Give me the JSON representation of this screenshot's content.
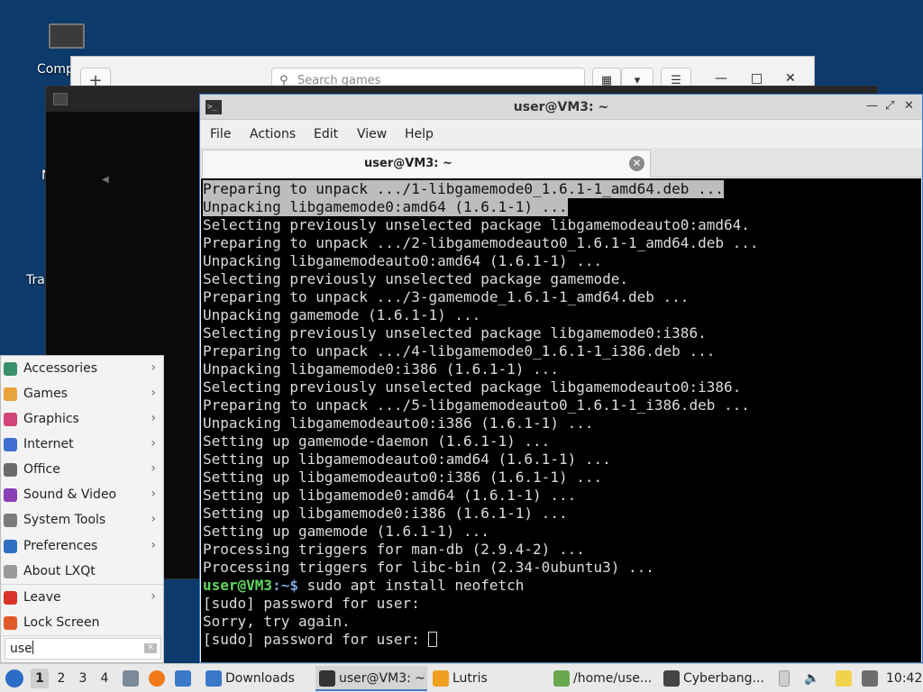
{
  "desktop": {
    "icons": [
      {
        "label": "Comp"
      },
      {
        "label": "N"
      },
      {
        "label": "Tra"
      }
    ]
  },
  "lutris_window": {
    "add_label": "+",
    "search_placeholder": "Search games"
  },
  "terminal": {
    "title": "user@VM3: ~",
    "menu": [
      "File",
      "Actions",
      "Edit",
      "View",
      "Help"
    ],
    "tab_label": "user@VM3: ~",
    "lines": [
      "Preparing to unpack .../1-libgamemode0_1.6.1-1_amd64.deb ...",
      "Unpacking libgamemode0:amd64 (1.6.1-1) ...",
      "Selecting previously unselected package libgamemodeauto0:amd64.",
      "Preparing to unpack .../2-libgamemodeauto0_1.6.1-1_amd64.deb ...",
      "Unpacking libgamemodeauto0:amd64 (1.6.1-1) ...",
      "Selecting previously unselected package gamemode.",
      "Preparing to unpack .../3-gamemode_1.6.1-1_amd64.deb ...",
      "Unpacking gamemode (1.6.1-1) ...",
      "Selecting previously unselected package libgamemode0:i386.",
      "Preparing to unpack .../4-libgamemode0_1.6.1-1_i386.deb ...",
      "Unpacking libgamemode0:i386 (1.6.1-1) ...",
      "Selecting previously unselected package libgamemodeauto0:i386.",
      "Preparing to unpack .../5-libgamemodeauto0_1.6.1-1_i386.deb ...",
      "Unpacking libgamemodeauto0:i386 (1.6.1-1) ...",
      "Setting up gamemode-daemon (1.6.1-1) ...",
      "Setting up libgamemodeauto0:amd64 (1.6.1-1) ...",
      "Setting up libgamemodeauto0:i386 (1.6.1-1) ...",
      "Setting up libgamemode0:amd64 (1.6.1-1) ...",
      "Setting up libgamemode0:i386 (1.6.1-1) ...",
      "Setting up gamemode (1.6.1-1) ...",
      "Processing triggers for man-db (2.9.4-2) ...",
      "Processing triggers for libc-bin (2.34-0ubuntu3) ..."
    ],
    "selected_line_count": 2,
    "prompt_user": "user@VM3",
    "prompt_sep": ":~$",
    "command": " sudo apt install neofetch",
    "after": [
      "[sudo] password for user:",
      "Sorry, try again.",
      "[sudo] password for user: "
    ]
  },
  "start_menu": {
    "items": [
      {
        "label": "Accessories",
        "icon": "accessories-icon",
        "color": "#3a8f6b",
        "submenu": true
      },
      {
        "label": "Games",
        "icon": "games-icon",
        "color": "#e8a33b",
        "submenu": true
      },
      {
        "label": "Graphics",
        "icon": "graphics-icon",
        "color": "#d1457a",
        "submenu": true
      },
      {
        "label": "Internet",
        "icon": "internet-icon",
        "color": "#3f6fd1",
        "submenu": true
      },
      {
        "label": "Office",
        "icon": "office-icon",
        "color": "#6b6b6b",
        "submenu": true
      },
      {
        "label": "Sound & Video",
        "icon": "sound-video-icon",
        "color": "#8a3fb5",
        "submenu": true
      },
      {
        "label": "System Tools",
        "icon": "system-tools-icon",
        "color": "#7a7a7a",
        "submenu": true
      },
      {
        "label": "Preferences",
        "icon": "preferences-icon",
        "color": "#2f6fc2",
        "submenu": true
      },
      {
        "label": "About LXQt",
        "icon": "info-icon",
        "color": "#9a9a9a",
        "submenu": false
      },
      {
        "label": "Leave",
        "icon": "power-icon",
        "color": "#d9342b",
        "submenu": true
      },
      {
        "label": "Lock Screen",
        "icon": "lock-icon",
        "color": "#e05a2b",
        "submenu": false
      }
    ],
    "search_value": "use"
  },
  "taskbar": {
    "workspaces": [
      "1",
      "2",
      "3",
      "4"
    ],
    "tasks": [
      {
        "label": "Downloads",
        "icon": "folder-icon",
        "color": "#3a78c9",
        "active": false
      },
      {
        "label": "user@VM3: ~",
        "icon": "terminal-icon",
        "color": "#333333",
        "active": true
      },
      {
        "label": "Lutris",
        "icon": "lutris-icon",
        "color": "#f0a020",
        "active": false
      },
      {
        "label": "/home/use...",
        "icon": "file-manager-icon",
        "color": "#6aa84f",
        "active": false
      },
      {
        "label": "Cyberbang...",
        "icon": "game-icon",
        "color": "#444444",
        "active": false
      }
    ],
    "clock": "10:42"
  }
}
